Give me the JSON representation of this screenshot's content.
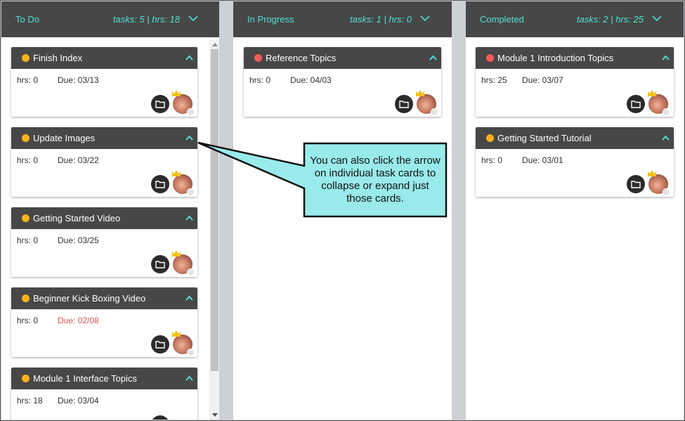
{
  "colors": {
    "header_bg": "#474747",
    "accent_teal": "#4fe0d0",
    "status_yellow": "#f5b21c",
    "status_red": "#f15a5a",
    "overdue_red": "#e0544f",
    "callout_fill": "#99eaea"
  },
  "columns": [
    {
      "title": "To Do",
      "stats": "tasks: 5 | hrs: 18",
      "cards": [
        {
          "title": "Finish Index",
          "hrs": "hrs: 0",
          "due": "Due: 03/13",
          "status": "yellow",
          "overdue": false
        },
        {
          "title": "Update Images",
          "hrs": "hrs: 0",
          "due": "Due: 03/22",
          "status": "yellow",
          "overdue": false
        },
        {
          "title": "Getting Started Video",
          "hrs": "hrs: 0",
          "due": "Due: 03/25",
          "status": "yellow",
          "overdue": false
        },
        {
          "title": "Beginner Kick Boxing Video",
          "hrs": "hrs: 0",
          "due": "Due: 02/08",
          "status": "yellow",
          "overdue": true
        },
        {
          "title": "Module 1 Interface Topics",
          "hrs": "hrs: 18",
          "due": "Due: 03/04",
          "status": "yellow",
          "overdue": false
        }
      ]
    },
    {
      "title": "In Progress",
      "stats": "tasks: 1 | hrs: 0",
      "cards": [
        {
          "title": "Reference Topics",
          "hrs": "hrs: 0",
          "due": "Due: 04/03",
          "status": "red",
          "overdue": false
        }
      ]
    },
    {
      "title": "Completed",
      "stats": "tasks: 2 | hrs: 25",
      "cards": [
        {
          "title": "Module 1 Introduction Topics",
          "hrs": "hrs: 25",
          "due": "Due: 03/07",
          "status": "red",
          "overdue": false
        },
        {
          "title": "Getting Started Tutorial",
          "hrs": "hrs: 0",
          "due": "Due: 03/01",
          "status": "yellow",
          "overdue": false
        }
      ]
    }
  ],
  "callout": {
    "text": "You can also click the arrow on individual task cards to collapse or expand just those cards."
  },
  "icons": {
    "column_collapse": "chevron-down-icon",
    "card_collapse": "chevron-up-icon",
    "card_folder": "folder-icon",
    "card_avatar": "avatar"
  }
}
